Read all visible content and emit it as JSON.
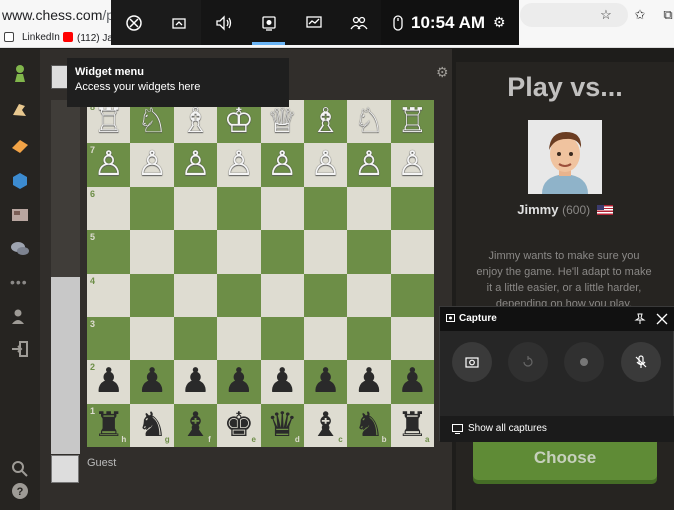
{
  "browser": {
    "url_host": "www.chess.com",
    "url_path": "/play/co",
    "bookmarks": [
      {
        "label": "LinkedIn",
        "color": "#0a66c2"
      },
      {
        "label": "(112) Ja",
        "color": "#ff0000"
      }
    ]
  },
  "gamebar": {
    "time": "10:54 AM",
    "icons": [
      "xbox-icon",
      "widget-store-icon",
      "audio-icon",
      "capture-icon",
      "performance-icon",
      "social-icon",
      "mouse-icon",
      "settings-icon"
    ]
  },
  "widget_tooltip": {
    "title": "Widget menu",
    "subtitle": "Access your widgets here"
  },
  "board": {
    "ranks": [
      "8",
      "7",
      "6",
      "5",
      "4",
      "3",
      "2",
      "1"
    ],
    "files": [
      "h",
      "g",
      "f",
      "e",
      "d",
      "c",
      "b",
      "a"
    ],
    "top_row": [
      "♖",
      "♘",
      "♗",
      "♔",
      "♕",
      "♗",
      "♘",
      "♖"
    ],
    "bottom_row": [
      "♜",
      "♞",
      "♝",
      "♚",
      "♛",
      "♝",
      "♞",
      "♜"
    ],
    "white_pawn": "♙",
    "black_pawn": "♟"
  },
  "player": {
    "guest_name": "Guest"
  },
  "bot_panel": {
    "title": "Play vs...",
    "bot_name": "Jimmy",
    "bot_rating": "(600)",
    "description": "Jimmy wants to make sure you enjoy the game. He'll adapt to make it a little easier, or a little harder, depending on how you play.",
    "choose_label": "Choose"
  },
  "capture": {
    "title": "Capture",
    "show_all_label": "Show all captures"
  },
  "colors": {
    "board_light": "#dedcd1",
    "board_dark": "#6d8e47",
    "accent_green": "#6a9e3a",
    "gamebar_active": "#6ab4f5"
  }
}
